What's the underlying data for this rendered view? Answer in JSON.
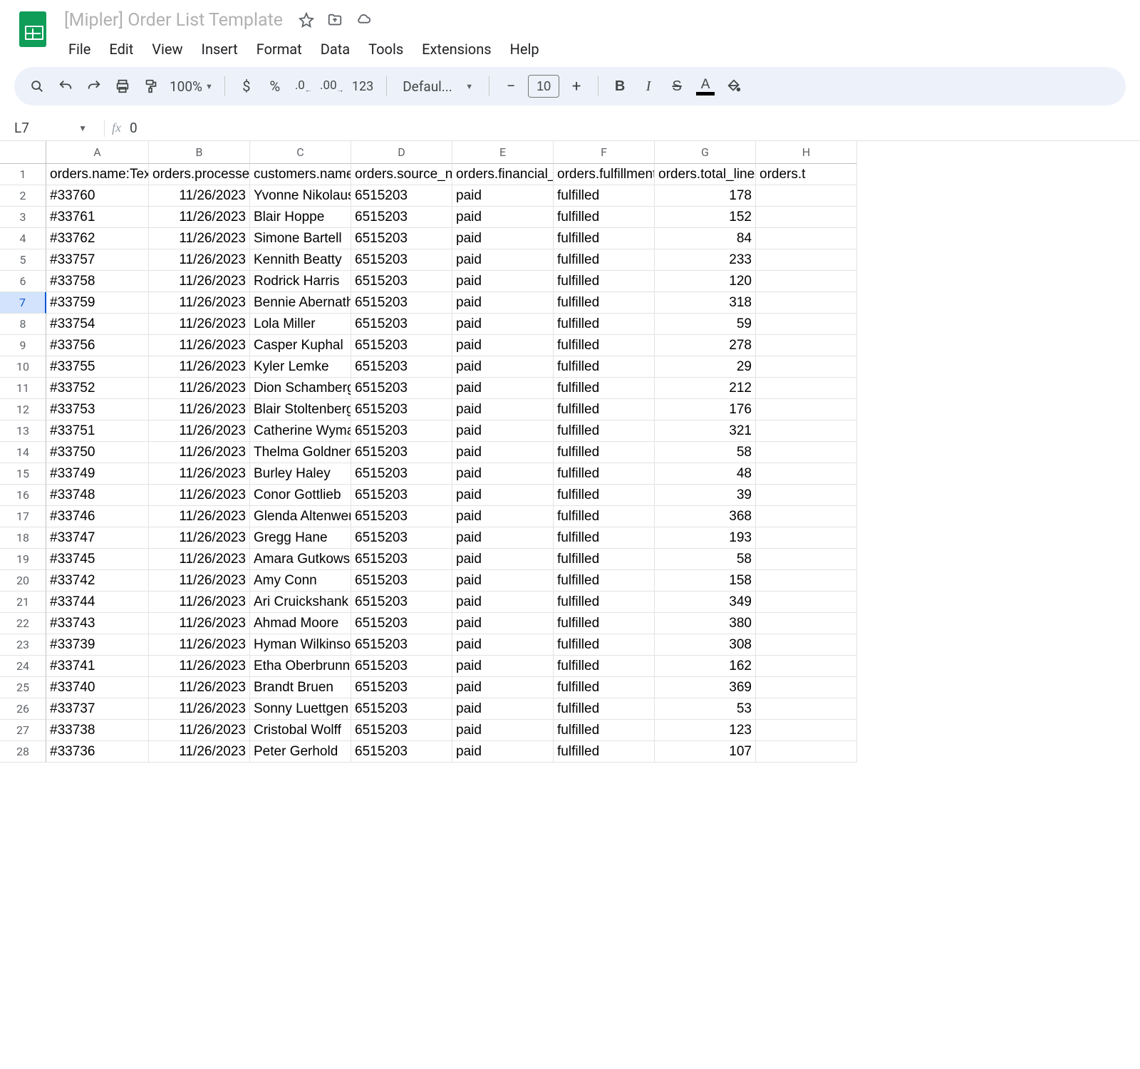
{
  "doc_title": "[Mipler] Order List Template",
  "menus": [
    "File",
    "Edit",
    "View",
    "Insert",
    "Format",
    "Data",
    "Tools",
    "Extensions",
    "Help"
  ],
  "toolbar": {
    "zoom": "100%",
    "font": "Defaul...",
    "font_size": "10",
    "currency_label": "$",
    "percent_label": "%",
    "num_fmt_label": "123"
  },
  "namebox": "L7",
  "formula_value": "0",
  "col_letters": [
    "A",
    "B",
    "C",
    "D",
    "E",
    "F",
    "G",
    "H"
  ],
  "col_classes": [
    "w-a",
    "w-b",
    "w-c",
    "w-d",
    "w-e",
    "w-f",
    "w-g",
    "w-h"
  ],
  "headers": [
    "orders.name:Text",
    "orders.processed",
    "customers.name",
    "orders.source_n",
    "orders.financial_",
    "orders.fulfillment",
    "orders.total_line",
    "orders.t"
  ],
  "selected_row_index": 5,
  "rowsers": 28,
  "rows": [
    [
      "#33760",
      "11/26/2023",
      "Yvonne Nikolaus",
      "6515203",
      "paid",
      "fulfilled",
      "178",
      ""
    ],
    [
      "#33761",
      "11/26/2023",
      "Blair Hoppe",
      "6515203",
      "paid",
      "fulfilled",
      "152",
      ""
    ],
    [
      "#33762",
      "11/26/2023",
      "Simone Bartell",
      "6515203",
      "paid",
      "fulfilled",
      "84",
      ""
    ],
    [
      "#33757",
      "11/26/2023",
      "Kennith Beatty",
      "6515203",
      "paid",
      "fulfilled",
      "233",
      ""
    ],
    [
      "#33758",
      "11/26/2023",
      "Rodrick Harris",
      "6515203",
      "paid",
      "fulfilled",
      "120",
      ""
    ],
    [
      "#33759",
      "11/26/2023",
      "Bennie Abernathy",
      "6515203",
      "paid",
      "fulfilled",
      "318",
      ""
    ],
    [
      "#33754",
      "11/26/2023",
      "Lola Miller",
      "6515203",
      "paid",
      "fulfilled",
      "59",
      ""
    ],
    [
      "#33756",
      "11/26/2023",
      "Casper Kuphal",
      "6515203",
      "paid",
      "fulfilled",
      "278",
      ""
    ],
    [
      "#33755",
      "11/26/2023",
      "Kyler Lemke",
      "6515203",
      "paid",
      "fulfilled",
      "29",
      ""
    ],
    [
      "#33752",
      "11/26/2023",
      "Dion Schamberger",
      "6515203",
      "paid",
      "fulfilled",
      "212",
      ""
    ],
    [
      "#33753",
      "11/26/2023",
      "Blair Stoltenberg",
      "6515203",
      "paid",
      "fulfilled",
      "176",
      ""
    ],
    [
      "#33751",
      "11/26/2023",
      "Catherine Wyman",
      "6515203",
      "paid",
      "fulfilled",
      "321",
      ""
    ],
    [
      "#33750",
      "11/26/2023",
      "Thelma Goldner",
      "6515203",
      "paid",
      "fulfilled",
      "58",
      ""
    ],
    [
      "#33749",
      "11/26/2023",
      "Burley Haley",
      "6515203",
      "paid",
      "fulfilled",
      "48",
      ""
    ],
    [
      "#33748",
      "11/26/2023",
      "Conor Gottlieb",
      "6515203",
      "paid",
      "fulfilled",
      "39",
      ""
    ],
    [
      "#33746",
      "11/26/2023",
      "Glenda Altenwerth",
      "6515203",
      "paid",
      "fulfilled",
      "368",
      ""
    ],
    [
      "#33747",
      "11/26/2023",
      "Gregg Hane",
      "6515203",
      "paid",
      "fulfilled",
      "193",
      ""
    ],
    [
      "#33745",
      "11/26/2023",
      "Amara Gutkowski",
      "6515203",
      "paid",
      "fulfilled",
      "58",
      ""
    ],
    [
      "#33742",
      "11/26/2023",
      "Amy Conn",
      "6515203",
      "paid",
      "fulfilled",
      "158",
      ""
    ],
    [
      "#33744",
      "11/26/2023",
      "Ari Cruickshank",
      "6515203",
      "paid",
      "fulfilled",
      "349",
      ""
    ],
    [
      "#33743",
      "11/26/2023",
      "Ahmad Moore",
      "6515203",
      "paid",
      "fulfilled",
      "380",
      ""
    ],
    [
      "#33739",
      "11/26/2023",
      "Hyman Wilkinson",
      "6515203",
      "paid",
      "fulfilled",
      "308",
      ""
    ],
    [
      "#33741",
      "11/26/2023",
      "Etha Oberbrunner",
      "6515203",
      "paid",
      "fulfilled",
      "162",
      ""
    ],
    [
      "#33740",
      "11/26/2023",
      "Brandt Bruen",
      "6515203",
      "paid",
      "fulfilled",
      "369",
      ""
    ],
    [
      "#33737",
      "11/26/2023",
      "Sonny Luettgen",
      "6515203",
      "paid",
      "fulfilled",
      "53",
      ""
    ],
    [
      "#33738",
      "11/26/2023",
      "Cristobal Wolff",
      "6515203",
      "paid",
      "fulfilled",
      "123",
      ""
    ],
    [
      "#33736",
      "11/26/2023",
      "Peter Gerhold",
      "6515203",
      "paid",
      "fulfilled",
      "107",
      ""
    ]
  ]
}
